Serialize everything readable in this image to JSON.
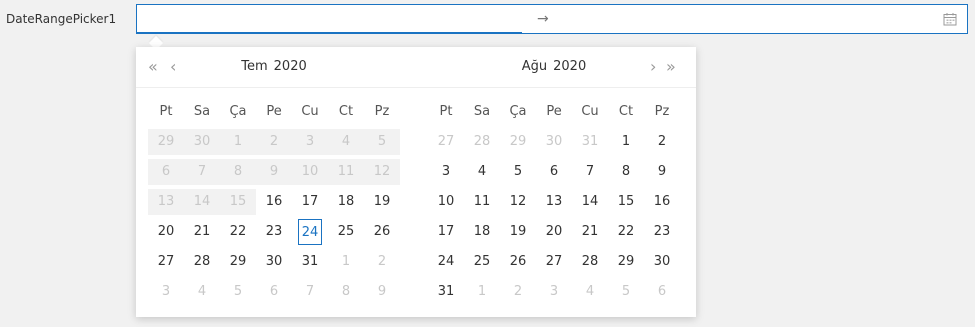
{
  "field": {
    "label": "DateRangePicker1",
    "separator": "→",
    "start_value": "",
    "end_value": ""
  },
  "icons": {
    "calendar": "calendar-icon",
    "prev_year": "«",
    "prev_month": "‹",
    "next_month": "›",
    "next_year": "»"
  },
  "colors": {
    "accent": "#1a73c2",
    "disabled_bg": "#f2f2f2",
    "muted_text": "#c8c8c8"
  },
  "weekdays": [
    "Pt",
    "Sa",
    "Ça",
    "Pe",
    "Cu",
    "Ct",
    "Pz"
  ],
  "left_calendar": {
    "month": "Tem",
    "year": "2020",
    "weeks": [
      [
        "29",
        "30",
        "1",
        "2",
        "3",
        "4",
        "5"
      ],
      [
        "6",
        "7",
        "8",
        "9",
        "10",
        "11",
        "12"
      ],
      [
        "13",
        "14",
        "15",
        "16",
        "17",
        "18",
        "19"
      ],
      [
        "20",
        "21",
        "22",
        "23",
        "24",
        "25",
        "26"
      ],
      [
        "27",
        "28",
        "29",
        "30",
        "31",
        "1",
        "2"
      ],
      [
        "3",
        "4",
        "5",
        "6",
        "7",
        "8",
        "9"
      ]
    ],
    "disabled_through": 16,
    "muted_tail": [
      [
        4,
        5
      ],
      [
        4,
        6
      ],
      [
        5,
        0
      ],
      [
        5,
        1
      ],
      [
        5,
        2
      ],
      [
        5,
        3
      ],
      [
        5,
        4
      ],
      [
        5,
        5
      ],
      [
        5,
        6
      ]
    ],
    "today": [
      3,
      4
    ]
  },
  "right_calendar": {
    "month": "Ağu",
    "year": "2020",
    "weeks": [
      [
        "27",
        "28",
        "29",
        "30",
        "31",
        "1",
        "2"
      ],
      [
        "3",
        "4",
        "5",
        "6",
        "7",
        "8",
        "9"
      ],
      [
        "10",
        "11",
        "12",
        "13",
        "14",
        "15",
        "16"
      ],
      [
        "17",
        "18",
        "19",
        "20",
        "21",
        "22",
        "23"
      ],
      [
        "24",
        "25",
        "26",
        "27",
        "28",
        "29",
        "30"
      ],
      [
        "31",
        "1",
        "2",
        "3",
        "4",
        "5",
        "6"
      ]
    ],
    "muted": [
      [
        0,
        0
      ],
      [
        0,
        1
      ],
      [
        0,
        2
      ],
      [
        0,
        3
      ],
      [
        0,
        4
      ],
      [
        5,
        1
      ],
      [
        5,
        2
      ],
      [
        5,
        3
      ],
      [
        5,
        4
      ],
      [
        5,
        5
      ],
      [
        5,
        6
      ]
    ]
  }
}
